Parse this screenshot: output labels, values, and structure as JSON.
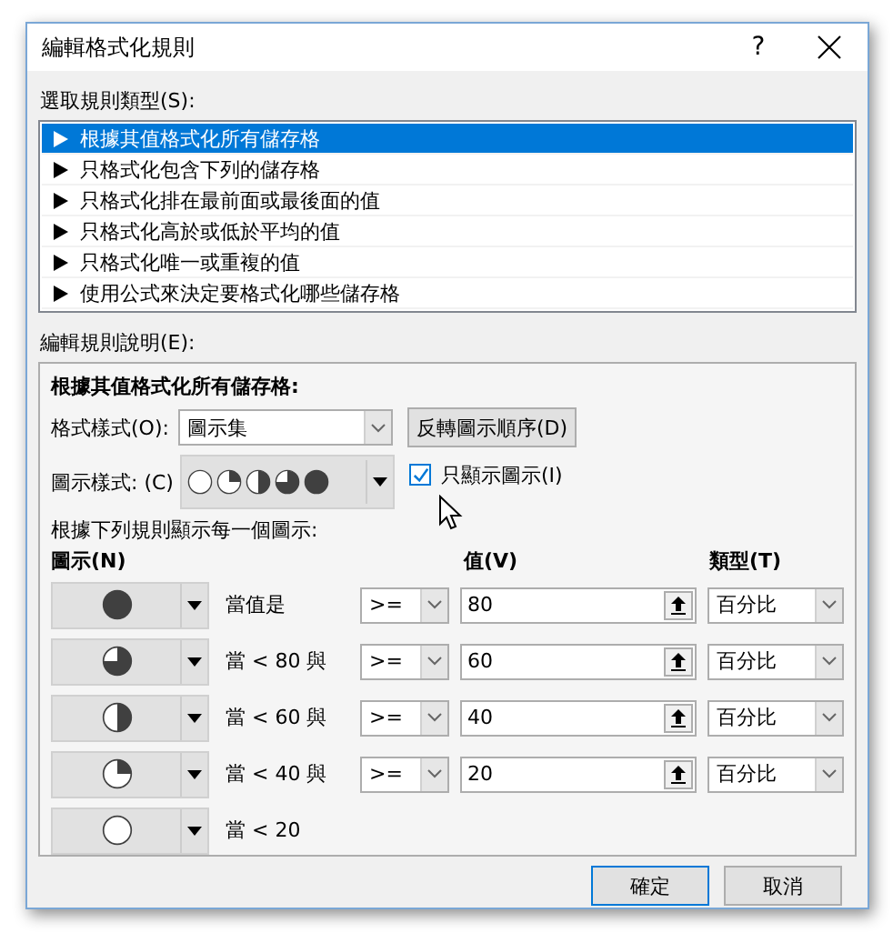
{
  "window": {
    "title": "編輯格式化規則",
    "help": "?"
  },
  "rule_type": {
    "label": "選取規則類型(S):",
    "items": [
      {
        "text": "根據其值格式化所有儲存格",
        "selected": true
      },
      {
        "text": "只格式化包含下列的儲存格",
        "selected": false
      },
      {
        "text": "只格式化排在最前面或最後面的值",
        "selected": false
      },
      {
        "text": "只格式化高於或低於平均的值",
        "selected": false
      },
      {
        "text": "只格式化唯一或重複的值",
        "selected": false
      },
      {
        "text": "使用公式來決定要格式化哪些儲存格",
        "selected": false
      }
    ]
  },
  "description": {
    "label": "編輯規則說明(E):",
    "heading": "根據其值格式化所有儲存格:",
    "format_style": {
      "label": "格式樣式(O):",
      "value": "圖示集"
    },
    "reverse_button": "反轉圖示順序(D)",
    "icon_style": {
      "label": "圖示樣式: (C)",
      "icons": [
        {
          "kind": "empty"
        },
        {
          "kind": "quarter"
        },
        {
          "kind": "half"
        },
        {
          "kind": "three_quarter"
        },
        {
          "kind": "full"
        }
      ]
    },
    "show_icon_only": {
      "label": "只顯示圖示(I)",
      "checked": true
    },
    "rules_caption": "根據下列規則顯示每一個圖示:",
    "columns": {
      "icon": "圖示(N)",
      "value": "值(V)",
      "type": "類型(T)"
    },
    "rules": [
      {
        "icon": {
          "kind": "full"
        },
        "condition": "當值是",
        "operator": ">=",
        "value": "80",
        "type": "百分比"
      },
      {
        "icon": {
          "kind": "three_quarter"
        },
        "condition": "當 < 80 與",
        "operator": ">=",
        "value": "60",
        "type": "百分比"
      },
      {
        "icon": {
          "kind": "half"
        },
        "condition": "當 < 60 與",
        "operator": ">=",
        "value": "40",
        "type": "百分比"
      },
      {
        "icon": {
          "kind": "quarter"
        },
        "condition": "當 < 40 與",
        "operator": ">=",
        "value": "20",
        "type": "百分比"
      },
      {
        "icon": {
          "kind": "empty"
        },
        "condition": "當 < 20"
      }
    ]
  },
  "buttons": [
    {
      "label": "確定",
      "default": true
    },
    {
      "label": "取消",
      "default": false
    }
  ]
}
